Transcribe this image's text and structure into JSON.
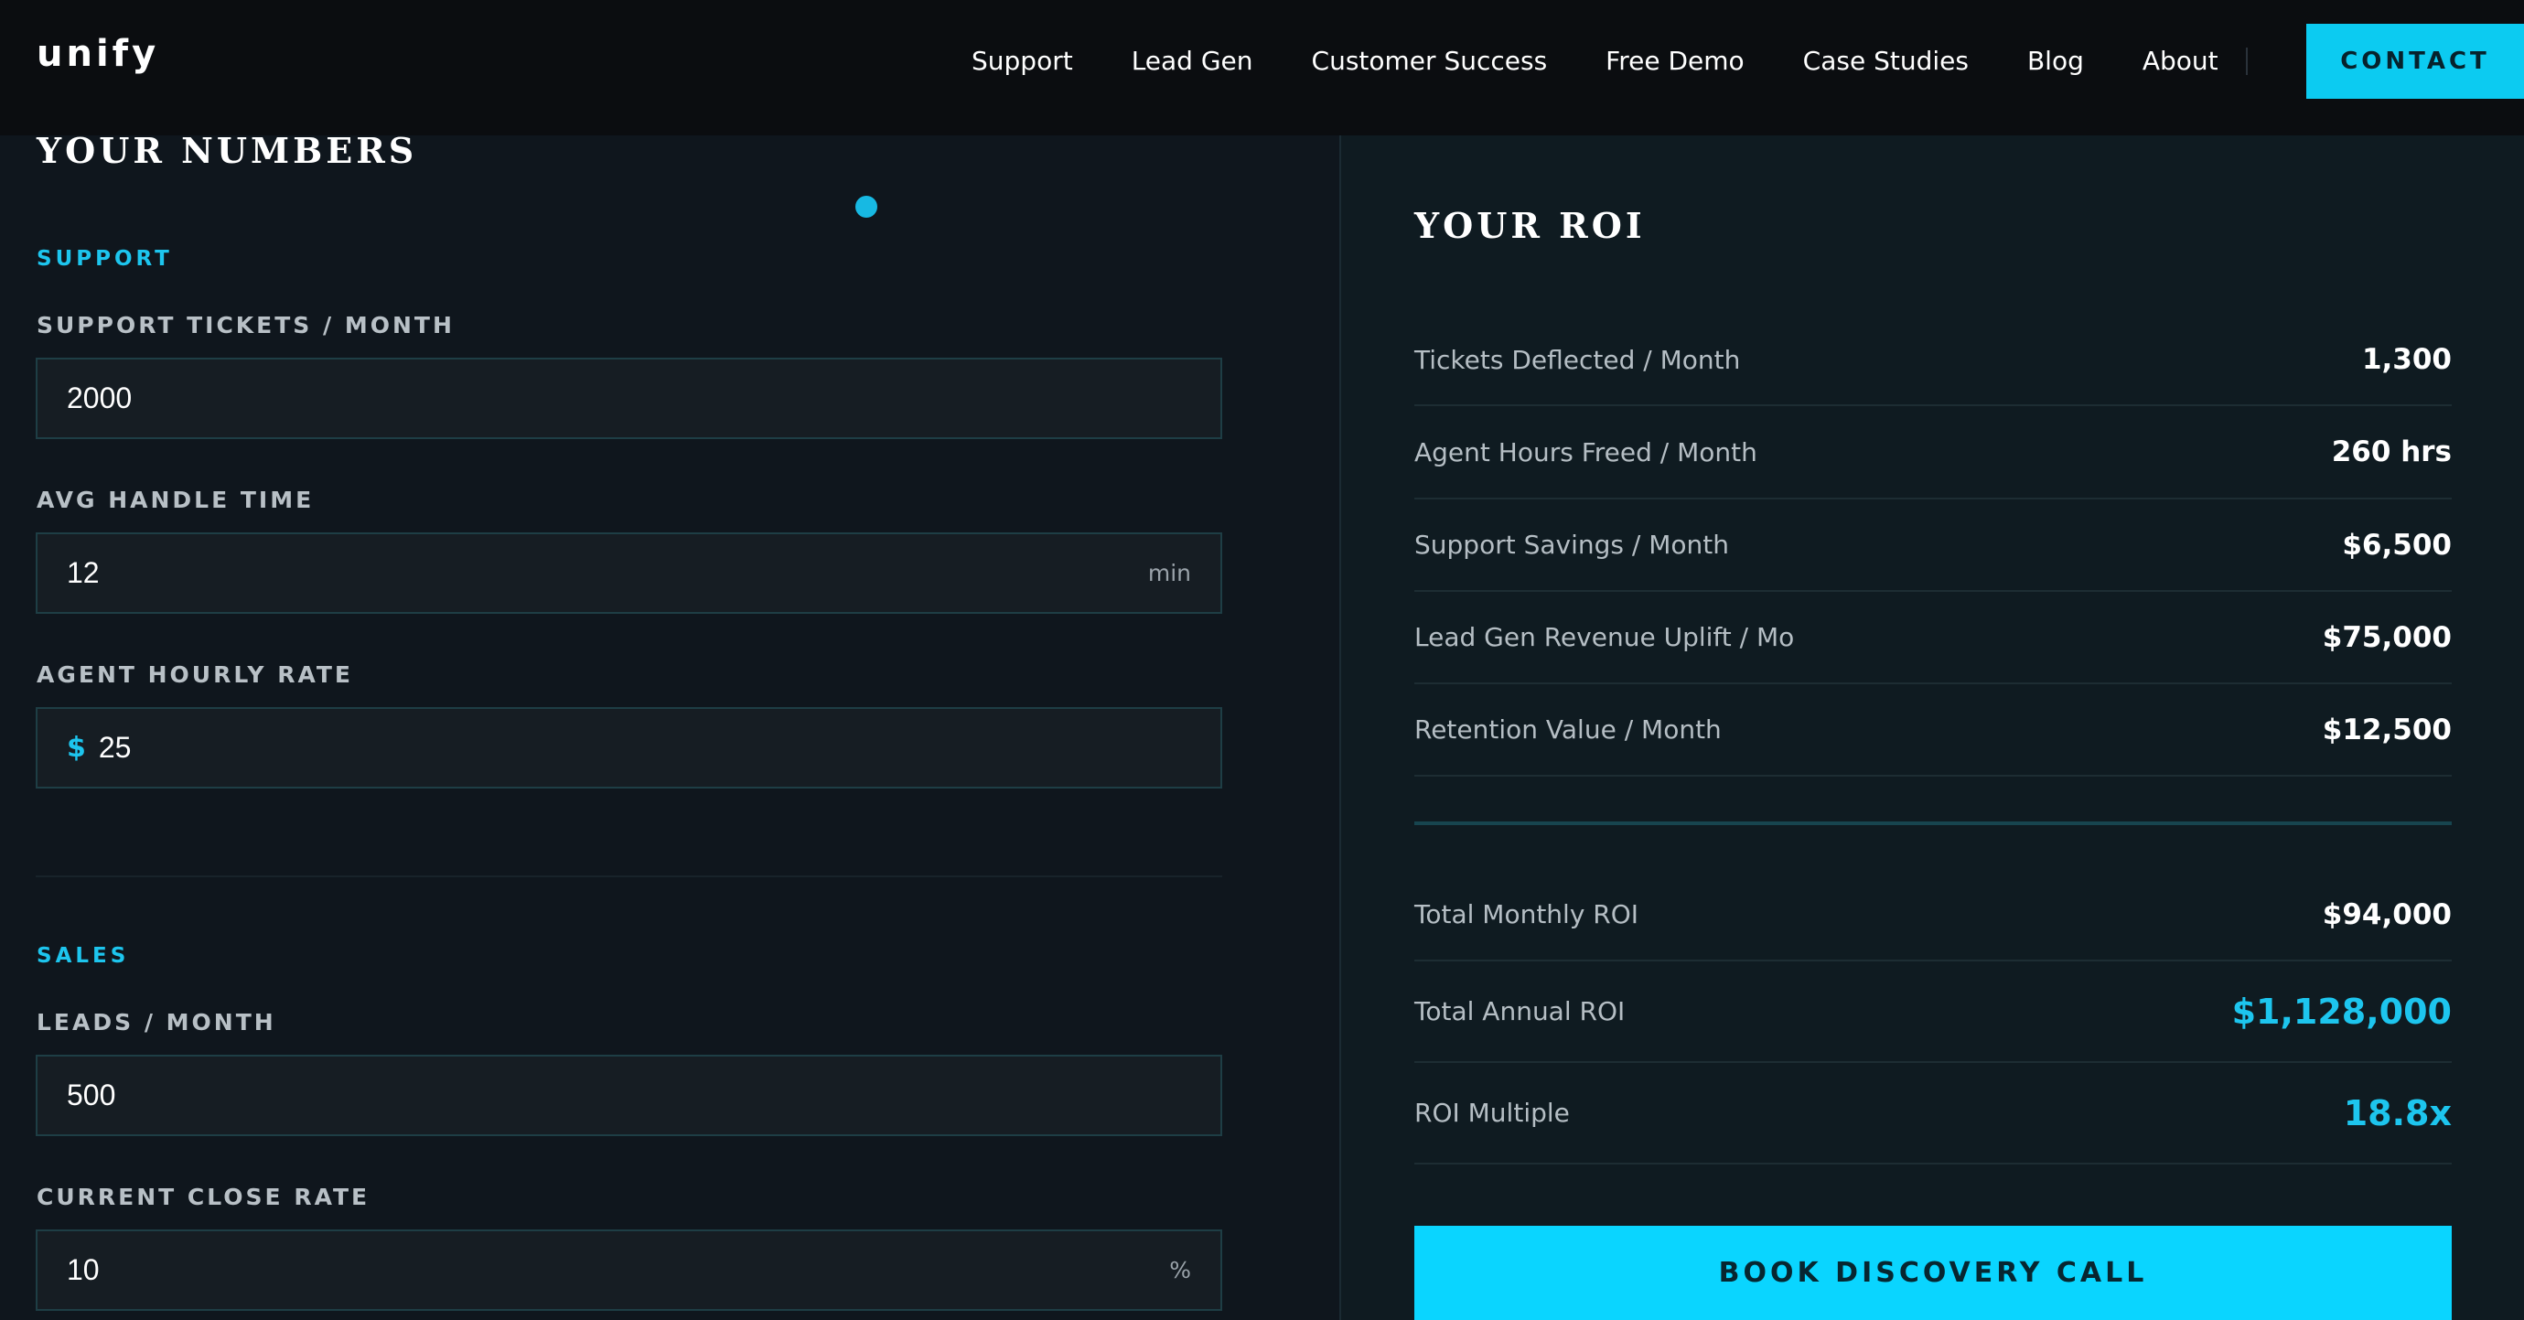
{
  "nav": {
    "logo": "unify",
    "links": [
      "Support",
      "Lead Gen",
      "Customer Success",
      "Free Demo",
      "Case Studies",
      "Blog",
      "About"
    ],
    "contact_label": "CONTACT"
  },
  "left": {
    "heading": "YOUR NUMBERS",
    "support_group": "SUPPORT",
    "tickets_label": "SUPPORT TICKETS / MONTH",
    "tickets_value": "2000",
    "handle_label": "AVG HANDLE TIME",
    "handle_value": "12",
    "handle_unit": "min",
    "rate_label": "AGENT HOURLY RATE",
    "rate_prefix": "$",
    "rate_value": "25",
    "sales_group": "SALES",
    "leads_label": "LEADS / MONTH",
    "leads_value": "500",
    "close_label": "CURRENT CLOSE RATE",
    "close_value": "10",
    "close_unit": "%"
  },
  "right": {
    "heading": "YOUR ROI",
    "rows": [
      {
        "label": "Tickets Deflected / Month",
        "value": "1,300"
      },
      {
        "label": "Agent Hours Freed / Month",
        "value": "260 hrs"
      },
      {
        "label": "Support Savings / Month",
        "value": "$6,500"
      },
      {
        "label": "Lead Gen Revenue Uplift / Mo",
        "value": "$75,000"
      },
      {
        "label": "Retention Value / Month",
        "value": "$12,500"
      }
    ],
    "totals": [
      {
        "label": "Total Monthly ROI",
        "value": "$94,000"
      },
      {
        "label": "Total Annual ROI",
        "value": "$1,128,000"
      },
      {
        "label": "ROI Multiple",
        "value": "18.8x"
      }
    ],
    "cta_label": "BOOK DISCOVERY CALL"
  },
  "colors": {
    "accent": "#0ccbf1",
    "background": "#0f161d",
    "nav_background": "#0b0d10"
  }
}
